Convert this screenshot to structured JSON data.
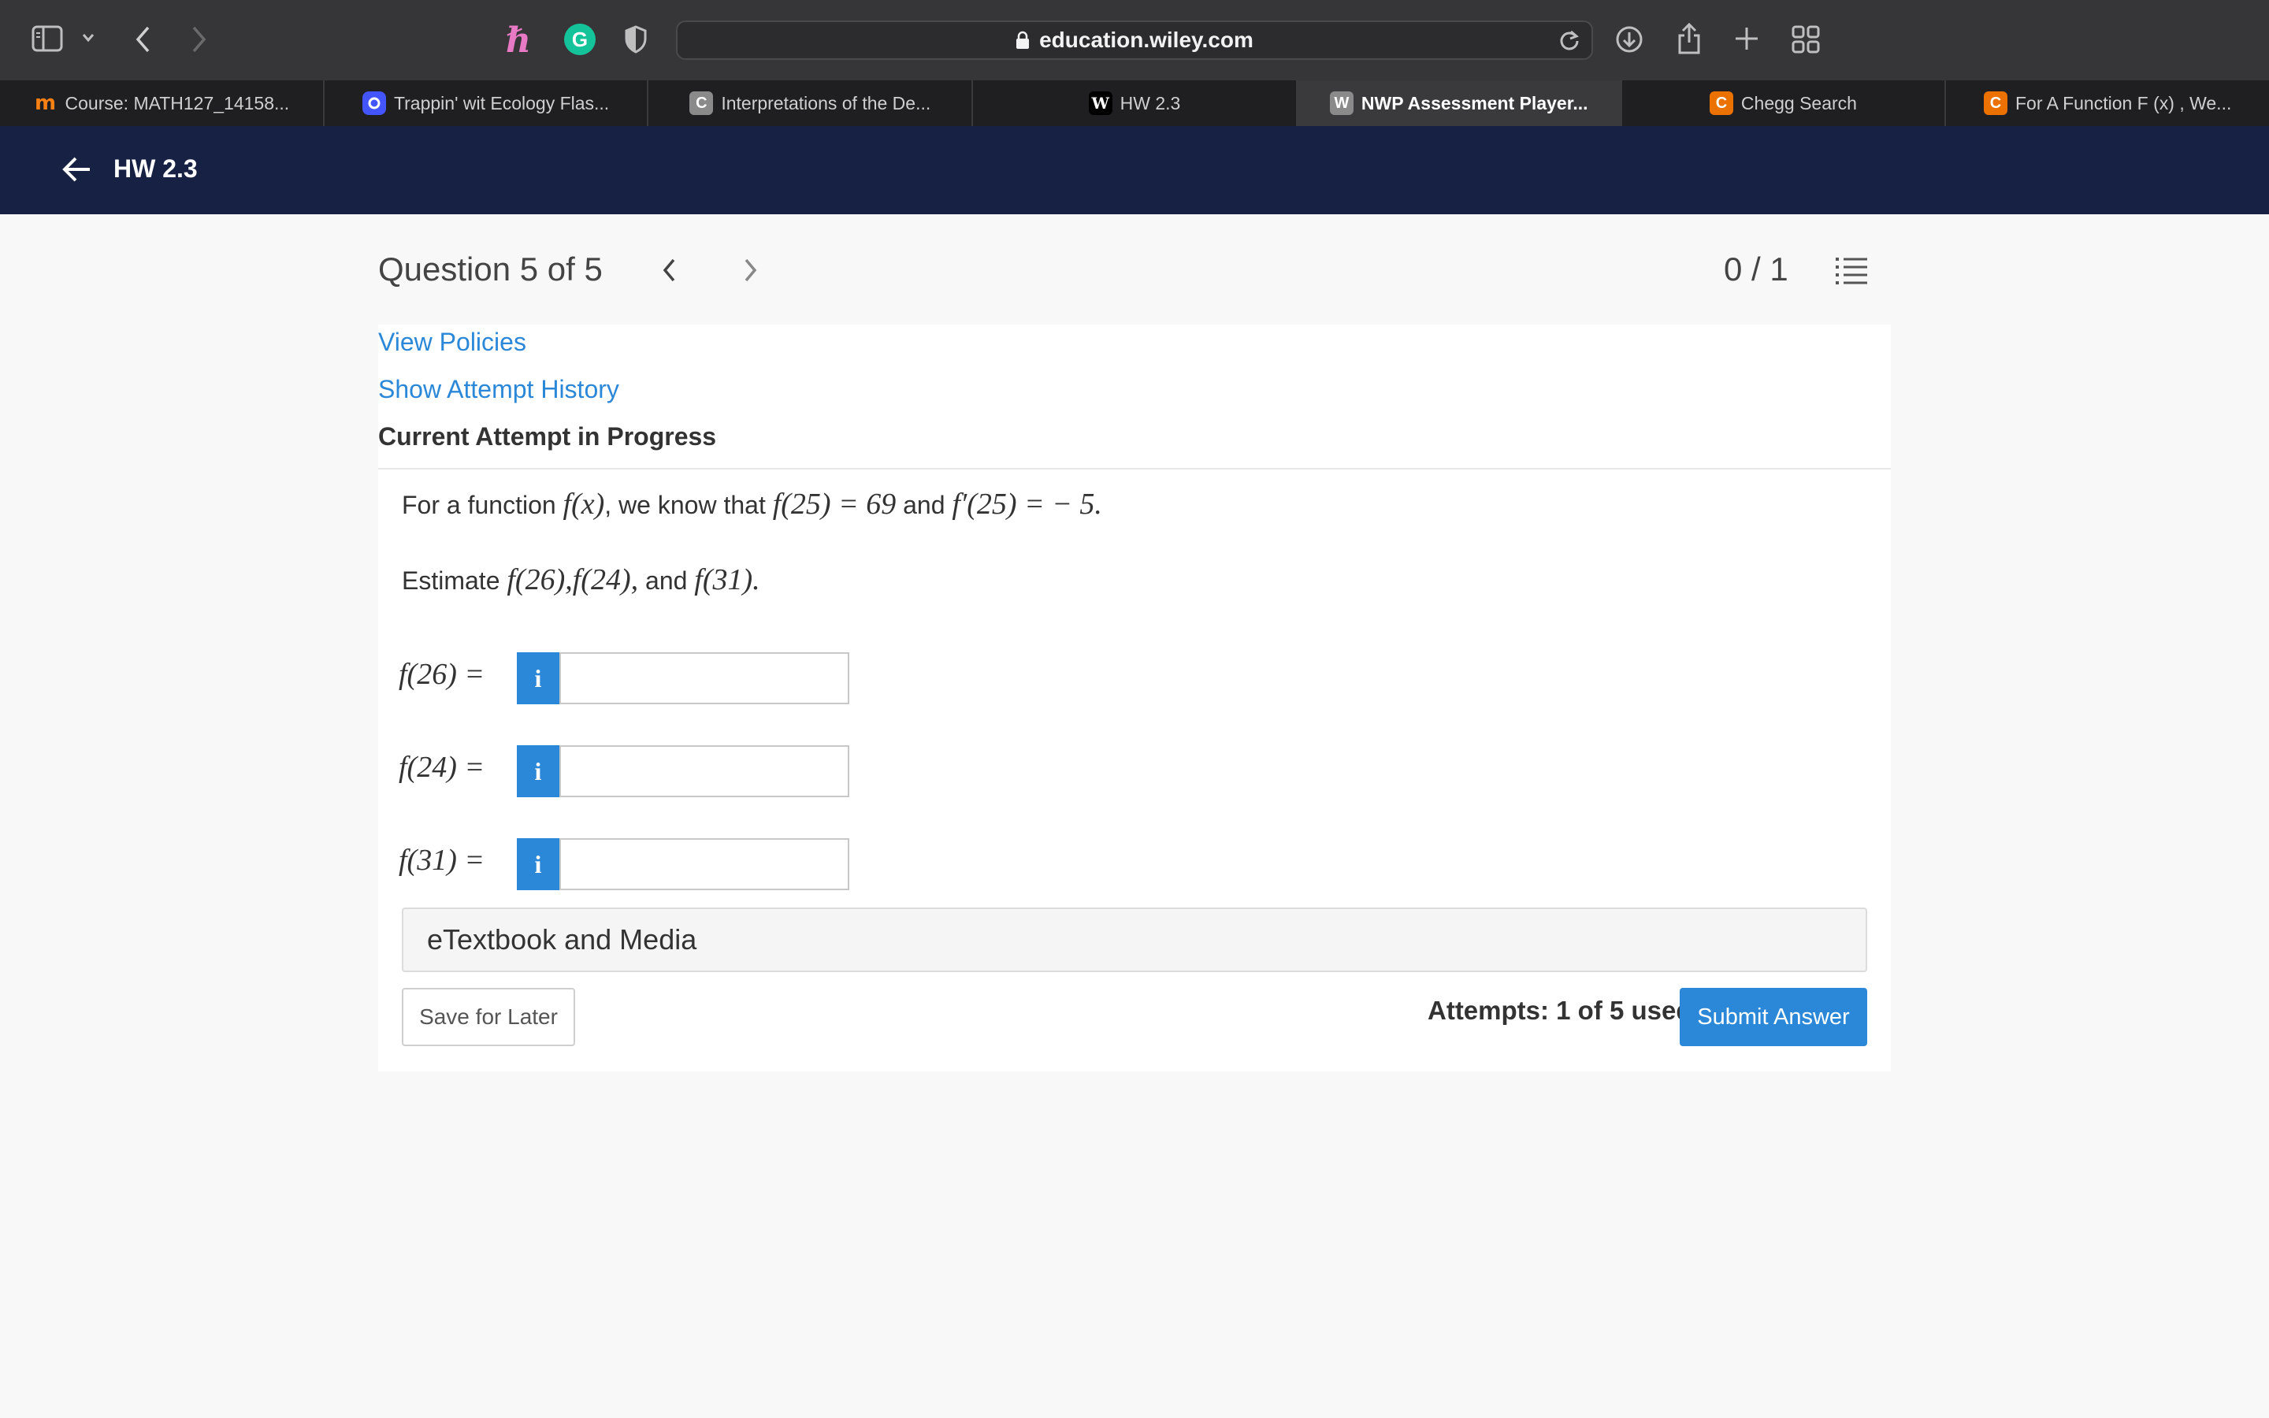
{
  "browser": {
    "url": "education.wiley.com",
    "tabs": [
      {
        "label": "Course: MATH127_14158...",
        "favicon": "moodle-m-icon",
        "color": "#f98012"
      },
      {
        "label": "Trappin' wit Ecology Flas...",
        "favicon": "quizlet-icon",
        "color": "#4255ff"
      },
      {
        "label": "Interpretations of the De...",
        "favicon": "c-icon",
        "color": "#8a8a8a",
        "glyph": "C"
      },
      {
        "label": "HW 2.3",
        "favicon": "wiley-w-icon",
        "color": "#000000",
        "glyph": "W"
      },
      {
        "label": "NWP Assessment Player...",
        "favicon": "wiley-w-icon",
        "color": "#8a8a8a",
        "glyph": "W",
        "active": true
      },
      {
        "label": "Chegg Search",
        "favicon": "chegg-c-icon",
        "color": "#eb7100",
        "glyph": "C"
      },
      {
        "label": "For A Function F (x) , We...",
        "favicon": "chegg-c-icon",
        "color": "#eb7100",
        "glyph": "C"
      }
    ]
  },
  "app": {
    "title": "HW 2.3"
  },
  "question": {
    "title": "Question 5 of 5",
    "score": "0 / 1",
    "view_policies": "View Policies",
    "show_history": "Show Attempt History",
    "attempt_heading": "Current Attempt in Progress",
    "text1": {
      "a": "For a function ",
      "b": ", we know that ",
      "c": " and ",
      "f_x": "f(x)",
      "f25": "f(25) = 69",
      "fp25": "f′(25) = − 5."
    },
    "text2": {
      "a": "Estimate ",
      "f26": "f(26),",
      "f24": "f(24),",
      "and": " and ",
      "f31": "f(31)."
    },
    "answers": [
      {
        "label": "f(26) =",
        "value": "",
        "info": "i"
      },
      {
        "label": "f(24) =",
        "value": "",
        "info": "i"
      },
      {
        "label": "f(31) =",
        "value": "",
        "info": "i"
      }
    ],
    "etextbook": "eTextbook and Media",
    "save_label": "Save for Later",
    "attempts": "Attempts: 1 of 5 used",
    "submit_label": "Submit Answer"
  },
  "colors": {
    "accent": "#2b88d8",
    "header": "#172144"
  }
}
